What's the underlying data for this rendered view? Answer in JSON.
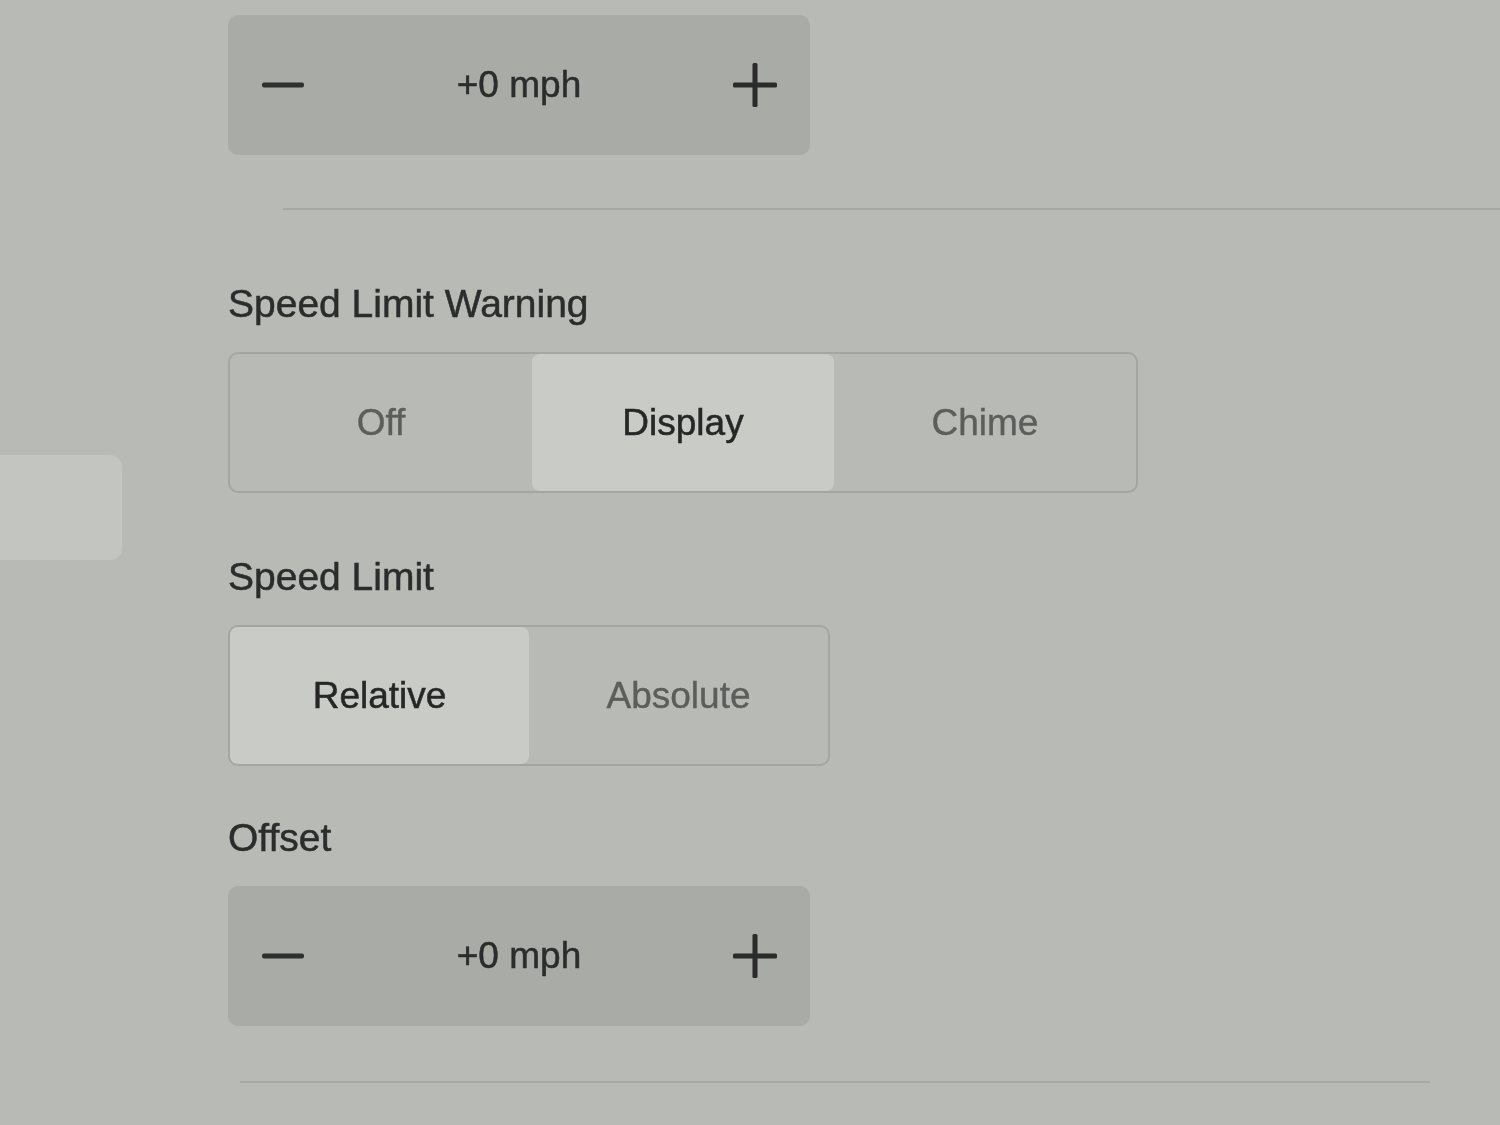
{
  "settings": [
    {
      "kind": "stepper",
      "value": "+0 mph"
    },
    {
      "kind": "segmented",
      "label": "Speed Limit Warning",
      "options": [
        {
          "label": "Off",
          "selected": false
        },
        {
          "label": "Display",
          "selected": true
        },
        {
          "label": "Chime",
          "selected": false
        }
      ]
    },
    {
      "kind": "segmented",
      "label": "Speed Limit",
      "options": [
        {
          "label": "Relative",
          "selected": true
        },
        {
          "label": "Absolute",
          "selected": false
        }
      ]
    },
    {
      "kind": "stepper",
      "label": "Offset",
      "value": "+0 mph"
    }
  ]
}
